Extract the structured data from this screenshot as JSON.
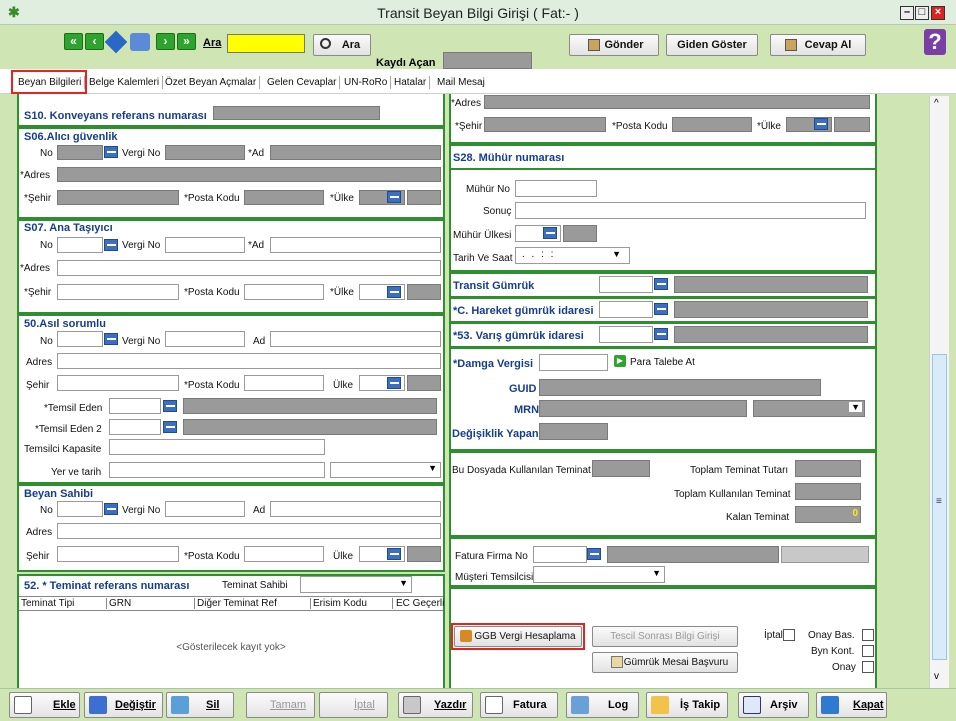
{
  "window": {
    "title": "Transit Beyan Bilgi Girişi ( Fat:- )"
  },
  "toolbar": {
    "ara_label": "Ara",
    "ara_button": "Ara",
    "kaydi_acan": "Kaydı Açan",
    "gonder": "Gönder",
    "giden_goster": "Giden Göster",
    "cevap_al": "Cevap Al"
  },
  "tabs": [
    "Beyan Bilgileri",
    "Belge Kalemleri",
    "Özet Beyan Açmalar",
    "Gelen Cevaplar",
    "UN-RoRo",
    "Hatalar",
    "Mail Mesaj"
  ],
  "left": {
    "s10": "S10. Konveyans referans numarası",
    "s06": {
      "title": "S06.Alıcı güvenlik",
      "no": "No",
      "vergi_no": "Vergi No",
      "ad": "*Ad",
      "adres": "*Adres",
      "sehir": "*Şehir",
      "posta": "*Posta Kodu",
      "ulke": "*Ülke"
    },
    "s07": {
      "title": "S07. Ana Taşıyıcı",
      "no": "No",
      "vergi_no": "Vergi No",
      "ad": "*Ad",
      "adres": "*Adres",
      "sehir": "*Şehir",
      "posta": "*Posta Kodu",
      "ulke": "*Ülke"
    },
    "s50": {
      "title": "50.Asıl sorumlu",
      "no": "No",
      "vergi_no": "Vergi No",
      "ad": "Ad",
      "adres": "Adres",
      "sehir": "Şehir",
      "posta": "*Posta Kodu",
      "ulke": "Ülke",
      "temsil": "*Temsil Eden",
      "temsil2": "*Temsil Eden 2",
      "kapasite": "Temsilci Kapasite",
      "yer": "Yer ve tarih"
    },
    "beyan": {
      "title": "Beyan Sahibi",
      "no": "No",
      "vergi_no": "Vergi No",
      "ad": "Ad",
      "adres": "Adres",
      "sehir": "Şehir",
      "posta": "*Posta Kodu",
      "ulke": "Ülke"
    },
    "s52": {
      "title": "52. * Teminat referans numarası",
      "sahibi": "Teminat Sahibi",
      "cols": [
        "Teminat Tipi",
        "GRN",
        "Diğer Teminat Ref",
        "Erisim Kodu",
        "EC Geçerli"
      ],
      "empty": "<Gösterilecek kayıt yok>"
    }
  },
  "right": {
    "adres": "*Adres",
    "sehir": "*Şehir",
    "posta": "*Posta Kodu",
    "ulke": "*Ülke",
    "s28": "S28. Mühür numarası",
    "muhur_no": "Mühür No",
    "sonuc": "Sonuç",
    "muhur_ulkesi": "Mühür Ülkesi",
    "tarih": "Tarih Ve Saat",
    "tarih_val": ". .    : :",
    "transit": "Transit Gümrük",
    "hareket": "*C. Hareket gümrük idaresi",
    "varis": "*53. Varış gümrük idaresi",
    "damga": "*Damga Vergisi",
    "para": "Para Talebe At",
    "guid": "GUID",
    "mrn": "MRN",
    "degisiklik": "Değişiklik Yapan",
    "bu_dosya": "Bu Dosyada Kullanılan Teminat",
    "toplam_tutar": "Toplam Teminat Tutarı",
    "toplam_kul": "Toplam Kullanılan Teminat",
    "kalan": "Kalan Teminat",
    "kalan_val": "0",
    "fatura_firma": "Fatura Firma No",
    "musteri": "Müşteri Temsilcisi",
    "ggb": "GGB Vergi Hesaplama",
    "tescil": "Tescil Sonrası Bilgi Girişi",
    "gumruk_mesai": "Gümrük Mesai Başvuru",
    "iptal": "İptal",
    "onay_bas": "Onay Bas.",
    "byn_kont": "Byn Kont.",
    "onay": "Onay"
  },
  "bottom": [
    "Ekle",
    "Değiştir",
    "Sil",
    "Tamam",
    "İptal",
    "Yazdır",
    "Fatura",
    "Log",
    "İş Takip",
    "Arşiv",
    "Kapat"
  ],
  "colors": {
    "accent": "#2d8f2d",
    "label": "#163d8e",
    "highlight": "#e8231e"
  }
}
